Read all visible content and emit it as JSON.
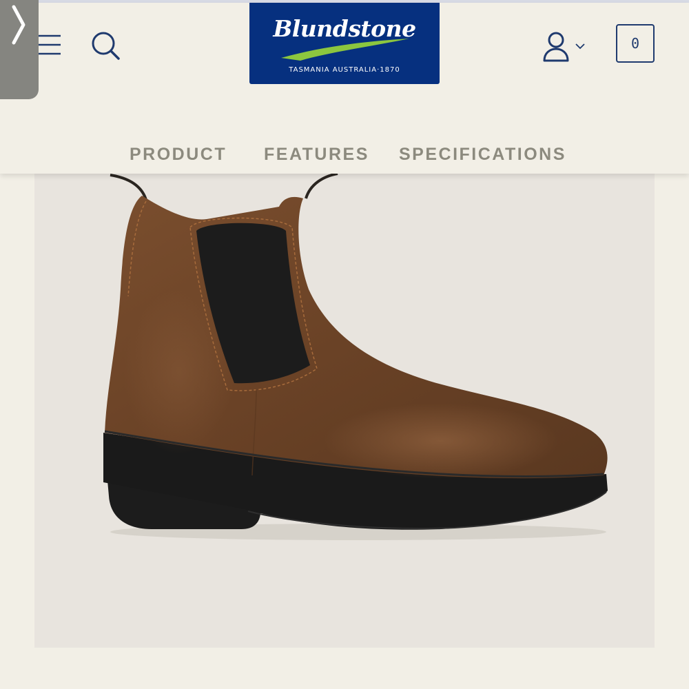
{
  "side_tab": {
    "icon": "chevron-right-icon"
  },
  "header": {
    "menu_icon": "hamburger-menu-icon",
    "search_icon": "search-icon",
    "logo": {
      "wordmark": "Blundstone",
      "tagline": "TASMANIA AUSTRALIA·1870",
      "colors": {
        "background": "#06307f",
        "swoosh": "#8cc63f",
        "text": "#ffffff"
      }
    },
    "account_icon": "user-icon",
    "account_chevron": "chevron-down-icon",
    "cart_count": "0"
  },
  "nav": {
    "tabs": [
      {
        "label": "PRODUCT"
      },
      {
        "label": "FEATURES"
      },
      {
        "label": "SPECIFICATIONS"
      }
    ]
  },
  "product": {
    "image": "brown-leather-chelsea-boot-with-heel",
    "colors": {
      "leather": "#6e4528",
      "elastic": "#1c1c1c",
      "sole": "#1a1a1a",
      "background": "#e8e4de"
    }
  },
  "colors": {
    "page_background": "#f2efe6",
    "brand_navy": "#1f3a6e",
    "tab_text": "#8c8a7e"
  }
}
